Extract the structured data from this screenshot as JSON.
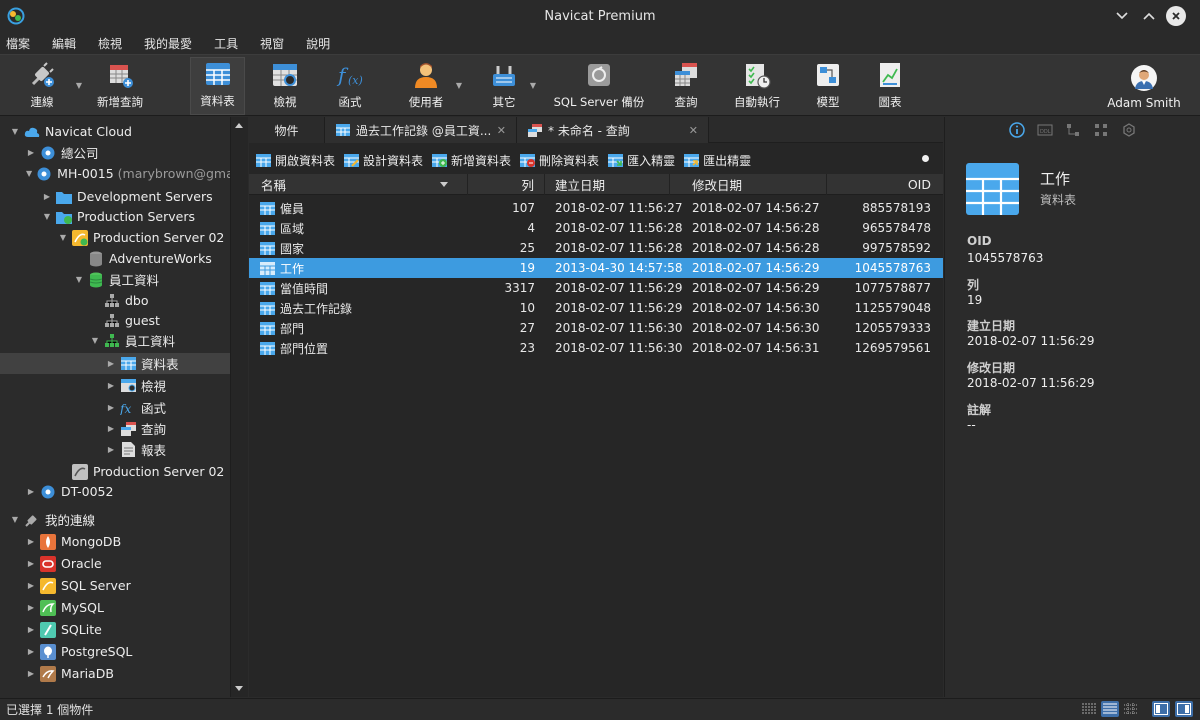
{
  "window": {
    "title": "Navicat Premium"
  },
  "menu": [
    "檔案",
    "編輯",
    "檢視",
    "我的最愛",
    "工具",
    "視窗",
    "說明"
  ],
  "toolbar": {
    "connect": "連線",
    "new_query": "新增查詢",
    "table": "資料表",
    "view": "檢視",
    "function": "函式",
    "user": "使用者",
    "other": "其它",
    "sqlserver_backup": "SQL Server 備份",
    "query": "查詢",
    "automation": "自動執行",
    "model": "模型",
    "chart": "圖表",
    "user_name": "Adam Smith"
  },
  "tree": {
    "cloud": "Navicat Cloud",
    "hq": "總公司",
    "mh": "MH-0015",
    "mh_user": "(marybrown@gma",
    "dev_servers": "Development Servers",
    "prod_servers": "Production Servers",
    "prod02": "Production Server 02",
    "adventure": "AdventureWorks",
    "emp_db": "員工資料",
    "dbo": "dbo",
    "guest": "guest",
    "emp_schema": "員工資料",
    "tables": "資料表",
    "views": "檢視",
    "functions": "函式",
    "queries": "查詢",
    "reports": "報表",
    "prod02b": "Production Server 02",
    "dt": "DT-0052",
    "my_conn": "我的連線",
    "mongodb": "MongoDB",
    "oracle": "Oracle",
    "sqlserver": "SQL Server",
    "mysql": "MySQL",
    "sqlite": "SQLite",
    "postgresql": "PostgreSQL",
    "mariadb": "MariaDB"
  },
  "tabs": {
    "objects": "物件",
    "tab1": "過去工作記錄 @員工資...",
    "tab2": "* 未命名 - 查詢"
  },
  "objbar": {
    "open": "開啟資料表",
    "design": "設計資料表",
    "new": "新增資料表",
    "delete": "刪除資料表",
    "import": "匯入精靈",
    "export": "匯出精靈"
  },
  "grid": {
    "headers": {
      "name": "名稱",
      "rows": "列",
      "created": "建立日期",
      "modified": "修改日期",
      "oid": "OID"
    },
    "rows": [
      {
        "name": "僱員",
        "rows": "107",
        "created": "2018-02-07 11:56:27",
        "modified": "2018-02-07 14:56:27",
        "oid": "885578193"
      },
      {
        "name": "區域",
        "rows": "4",
        "created": "2018-02-07 11:56:28",
        "modified": "2018-02-07 14:56:28",
        "oid": "965578478"
      },
      {
        "name": "國家",
        "rows": "25",
        "created": "2018-02-07 11:56:28",
        "modified": "2018-02-07 14:56:28",
        "oid": "997578592"
      },
      {
        "name": "工作",
        "rows": "19",
        "created": "2013-04-30 14:57:58",
        "modified": "2018-02-07 14:56:29",
        "oid": "1045578763"
      },
      {
        "name": "當值時間",
        "rows": "3317",
        "created": "2018-02-07 11:56:29",
        "modified": "2018-02-07 14:56:29",
        "oid": "1077578877"
      },
      {
        "name": "過去工作記錄",
        "rows": "10",
        "created": "2018-02-07 11:56:29",
        "modified": "2018-02-07 14:56:30",
        "oid": "1125579048"
      },
      {
        "name": "部門",
        "rows": "27",
        "created": "2018-02-07 11:56:30",
        "modified": "2018-02-07 14:56:30",
        "oid": "1205579333"
      },
      {
        "name": "部門位置",
        "rows": "23",
        "created": "2018-02-07 11:56:30",
        "modified": "2018-02-07 14:56:31",
        "oid": "1269579561"
      }
    ]
  },
  "info": {
    "name": "工作",
    "type": "資料表",
    "oid_label": "OID",
    "oid": "1045578763",
    "rows_label": "列",
    "rows": "19",
    "created_label": "建立日期",
    "created": "2018-02-07 11:56:29",
    "modified_label": "修改日期",
    "modified": "2018-02-07 11:56:29",
    "comment_label": "註解",
    "comment": "--"
  },
  "status": {
    "text": "已選擇 1 個物件"
  }
}
